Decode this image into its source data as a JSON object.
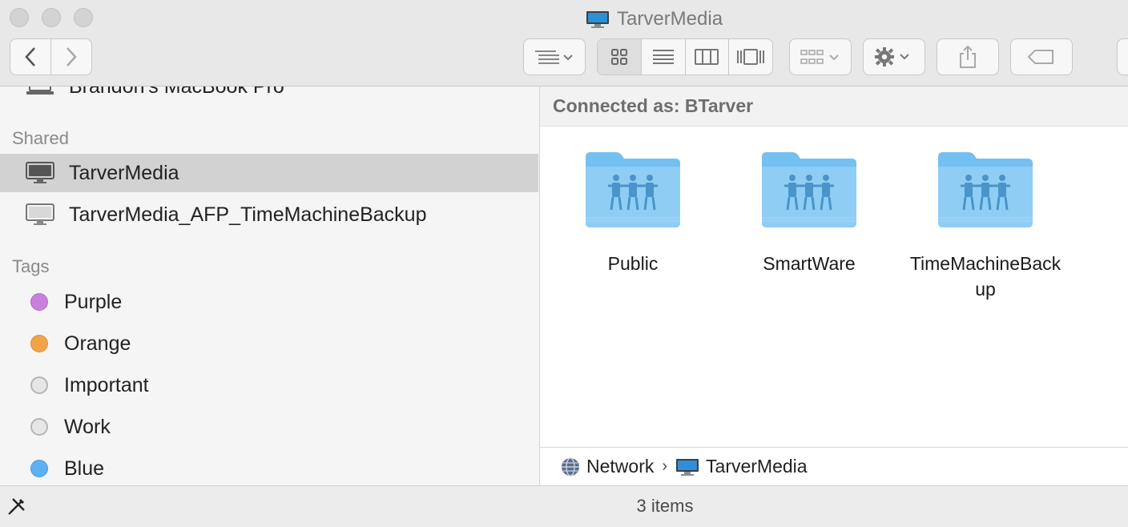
{
  "window": {
    "title": "TarverMedia"
  },
  "toolbar": {
    "back_icon": "chevron-left-icon",
    "forward_icon": "chevron-right-icon",
    "arrange_icon": "list-arrange-icon",
    "view_modes": [
      "icon-view",
      "list-view",
      "column-view",
      "cover-flow-view"
    ],
    "group_icon": "group-icon",
    "action_icon": "gear-icon",
    "share_icon": "share-icon",
    "tag_icon": "tag-icon"
  },
  "sidebar": {
    "device_partial": "Brandon's MacBook Pro",
    "shared_header": "Shared",
    "shared_items": [
      {
        "label": "TarverMedia",
        "selected": true
      },
      {
        "label": "TarverMedia_AFP_TimeMachineBackup",
        "selected": false
      }
    ],
    "tags_header": "Tags",
    "tags": [
      {
        "label": "Purple",
        "color": "#c97fdc"
      },
      {
        "label": "Orange",
        "color": "#f2a34a"
      },
      {
        "label": "Important",
        "color": "#e6e6e6"
      },
      {
        "label": "Work",
        "color": "#e6e6e6"
      },
      {
        "label": "Blue",
        "color": "#5fb0f0"
      }
    ]
  },
  "main": {
    "connected_as": "Connected as: BTarver",
    "folders": [
      {
        "label": "Public"
      },
      {
        "label": "SmartWare"
      },
      {
        "label": "TimeMachineBackup"
      }
    ],
    "folder_color": "#74c0f2",
    "pathbar": {
      "items": [
        "Network",
        "TarverMedia"
      ]
    }
  },
  "status": {
    "text": "3 items"
  }
}
